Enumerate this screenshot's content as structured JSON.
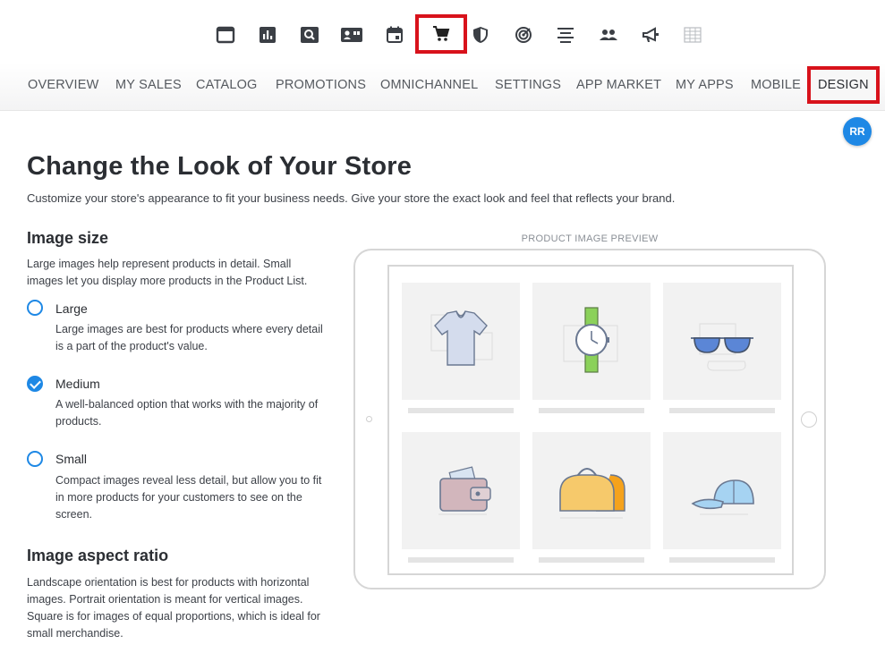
{
  "toolbar": {
    "icons": [
      {
        "name": "dashboard-icon"
      },
      {
        "name": "reports-icon"
      },
      {
        "name": "search-icon"
      },
      {
        "name": "contacts-icon"
      },
      {
        "name": "calendar-icon"
      },
      {
        "name": "cart-icon",
        "active": true
      },
      {
        "name": "shield-icon"
      },
      {
        "name": "target-icon"
      },
      {
        "name": "align-icon"
      },
      {
        "name": "users-icon"
      },
      {
        "name": "megaphone-icon"
      },
      {
        "name": "table-icon"
      }
    ]
  },
  "nav": {
    "tabs": [
      {
        "label": "OVERVIEW"
      },
      {
        "label": "MY SALES"
      },
      {
        "label": "CATALOG"
      },
      {
        "label": "PROMOTIONS"
      },
      {
        "label": "OMNICHANNEL"
      },
      {
        "label": "SETTINGS"
      },
      {
        "label": "APP MARKET"
      },
      {
        "label": "MY APPS"
      },
      {
        "label": "MOBILE"
      },
      {
        "label": "DESIGN",
        "active": true
      }
    ]
  },
  "user": {
    "initials": "RR"
  },
  "page": {
    "title": "Change the Look of Your Store",
    "subtitle": "Customize your store's appearance to fit your business needs. Give your store the exact look and feel that reflects your brand."
  },
  "image_size": {
    "title": "Image size",
    "description": "Large images help represent products in detail. Small images let you display more products in the Product List.",
    "options": [
      {
        "label": "Large",
        "description": "Large images are best for products where every detail is a part of the product's value.",
        "checked": false
      },
      {
        "label": "Medium",
        "description": "A well-balanced option that works with the majority of products.",
        "checked": true
      },
      {
        "label": "Small",
        "description": "Compact images reveal less detail, but allow you to fit in more products for your customers to see on the screen.",
        "checked": false
      }
    ]
  },
  "aspect_ratio": {
    "title": "Image aspect ratio",
    "description": "Landscape orientation is best for products with horizontal images. Portrait orientation is meant for vertical images. Square is for images of equal proportions, which is ideal for small merchandise."
  },
  "preview": {
    "caption": "PRODUCT IMAGE PREVIEW",
    "products": [
      {
        "name": "t-shirt-illustration"
      },
      {
        "name": "watch-illustration"
      },
      {
        "name": "sunglasses-illustration"
      },
      {
        "name": "wallet-illustration"
      },
      {
        "name": "bag-illustration"
      },
      {
        "name": "cap-illustration"
      }
    ]
  },
  "colors": {
    "accent": "#1e88e5",
    "highlight": "#d8121b"
  }
}
